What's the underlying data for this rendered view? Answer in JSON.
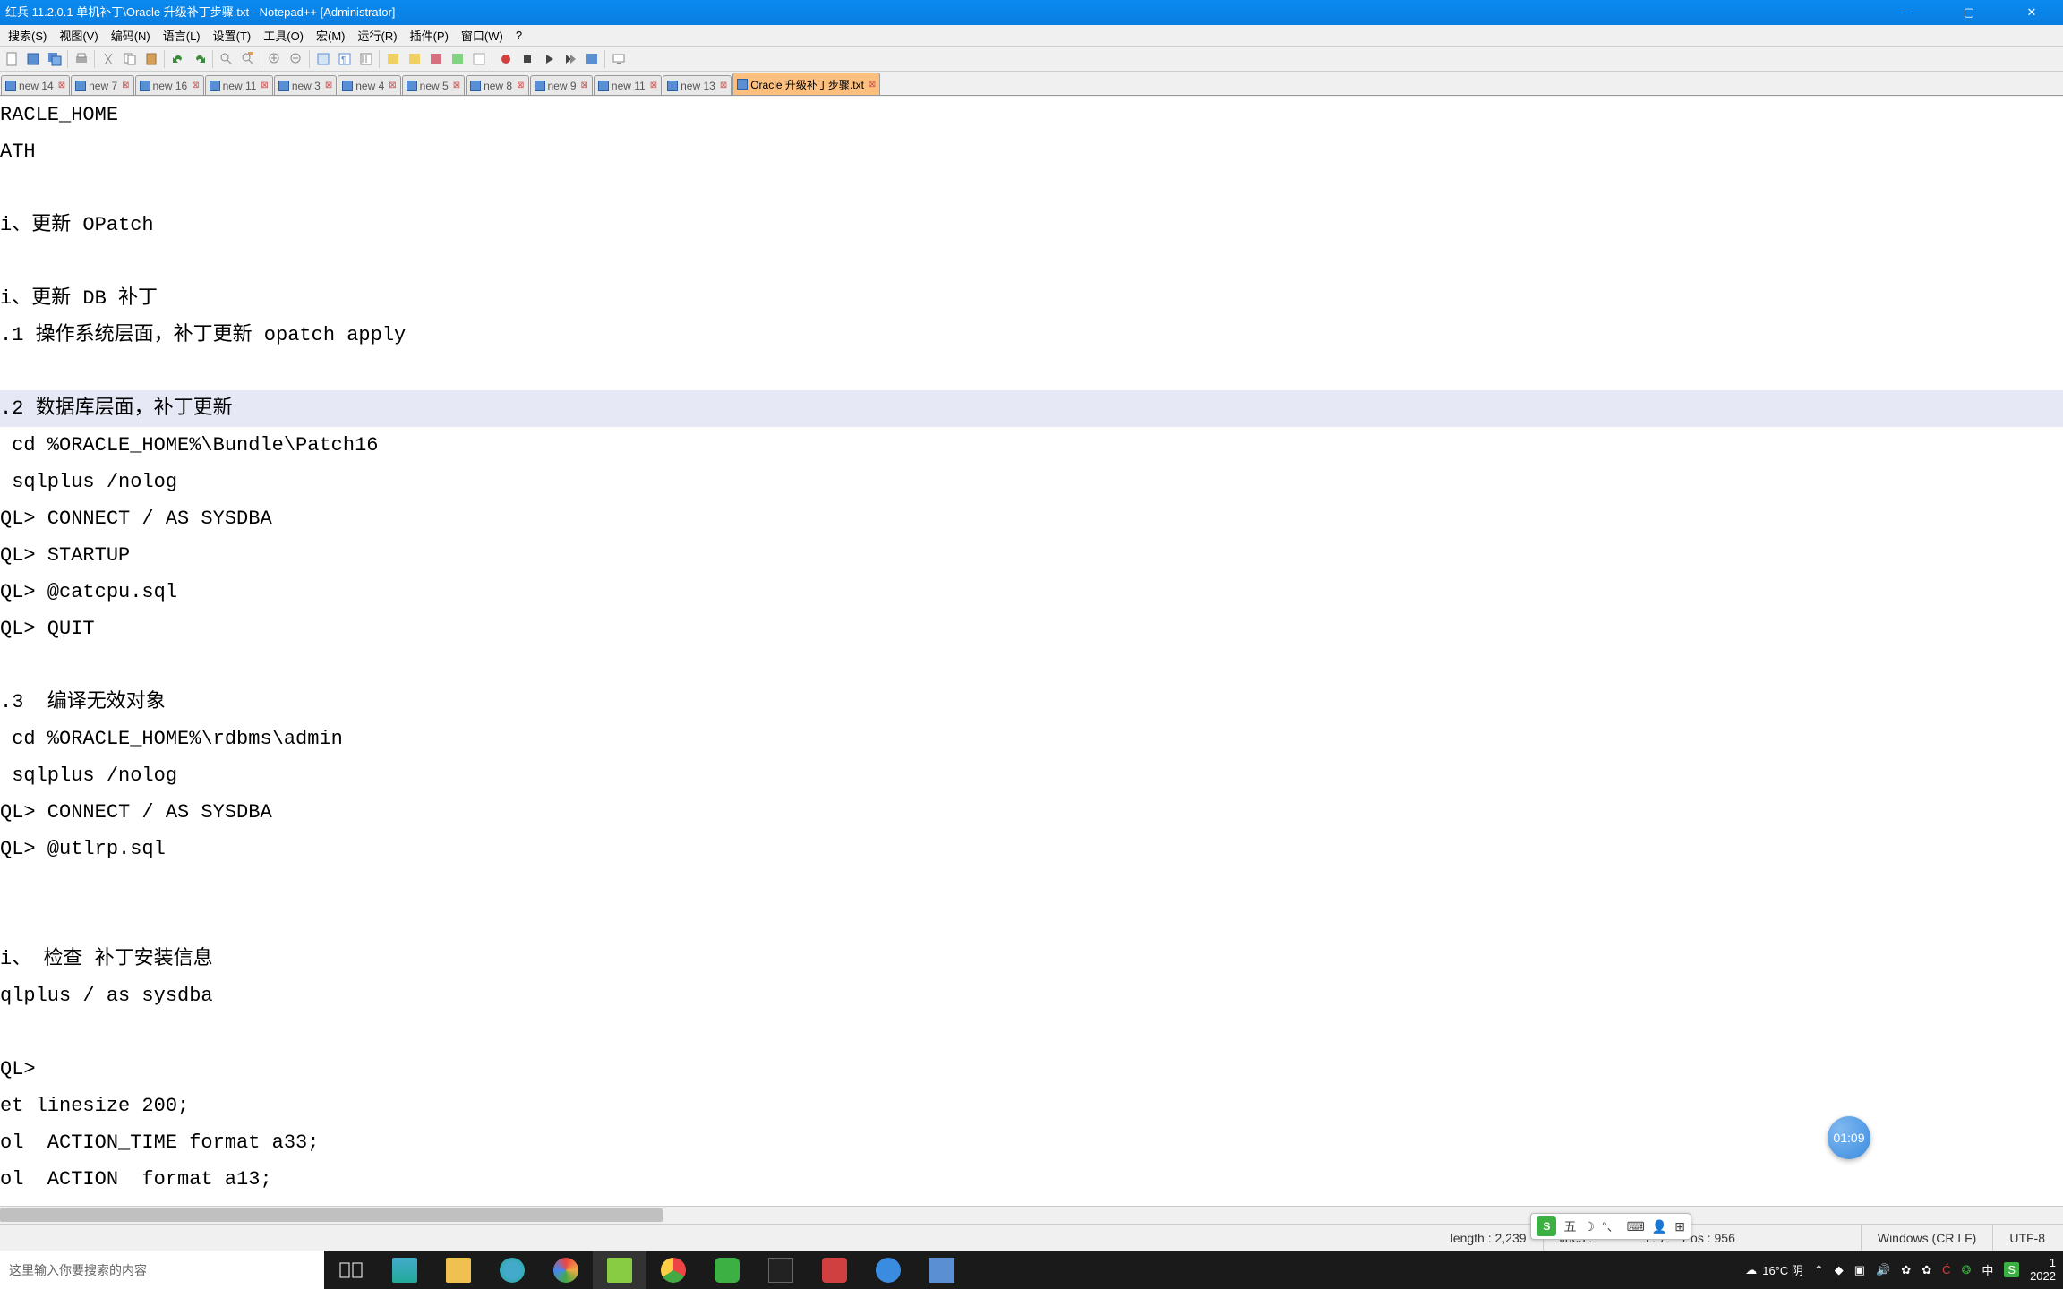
{
  "title": "红兵 11.2.0.1 单机补丁\\Oracle 升级补丁步骤.txt - Notepad++ [Administrator]",
  "menu": [
    "搜索(S)",
    "视图(V)",
    "编码(N)",
    "语言(L)",
    "设置(T)",
    "工具(O)",
    "宏(M)",
    "运行(R)",
    "插件(P)",
    "窗口(W)",
    "?"
  ],
  "tabs": [
    {
      "label": "new 14"
    },
    {
      "label": "new 7"
    },
    {
      "label": "new 16"
    },
    {
      "label": "new 11"
    },
    {
      "label": "new 3"
    },
    {
      "label": "new 4"
    },
    {
      "label": "new 5"
    },
    {
      "label": "new 8"
    },
    {
      "label": "new 9"
    },
    {
      "label": "new 11"
    },
    {
      "label": "new 13"
    },
    {
      "label": "Oracle 升级补丁步骤.txt",
      "active": true
    }
  ],
  "lines": [
    "RACLE_HOME",
    "ATH",
    "",
    "i、更新 OPatch",
    "",
    "i、更新 DB 补丁",
    ".1 操作系统层面，补丁更新 opatch apply",
    "",
    ".2 数据库层面，补丁更新",
    " cd %ORACLE_HOME%\\Bundle\\Patch16",
    " sqlplus /nolog",
    "QL> CONNECT / AS SYSDBA",
    "QL> STARTUP",
    "QL> @catcpu.sql",
    "QL> QUIT",
    "",
    ".3  编译无效对象",
    " cd %ORACLE_HOME%\\rdbms\\admin",
    " sqlplus /nolog",
    "QL> CONNECT / AS SYSDBA",
    "QL> @utlrp.sql",
    "",
    "",
    "i、 检查 补丁安装信息",
    "qlplus / as sysdba",
    "",
    "QL>",
    "et linesize 200;",
    "ol  ACTION_TIME format a33;",
    "ol  ACTION  format a13;"
  ],
  "highlightLine": 8,
  "status": {
    "length": "length : 2,239",
    "lines": "lines :",
    "lncol": "l : 7",
    "pos": "Pos : 956",
    "eol": "Windows (CR LF)",
    "enc": "UTF-8"
  },
  "imeFloat": [
    "五",
    "☽",
    "°、",
    "⌨",
    "👤",
    "⊞"
  ],
  "clockBubble": "01:09",
  "searchPlaceholder": "这里输入你要搜索的内容",
  "weather": "16°C 阴",
  "trayClock": {
    "t": "1",
    "d": "2022"
  }
}
